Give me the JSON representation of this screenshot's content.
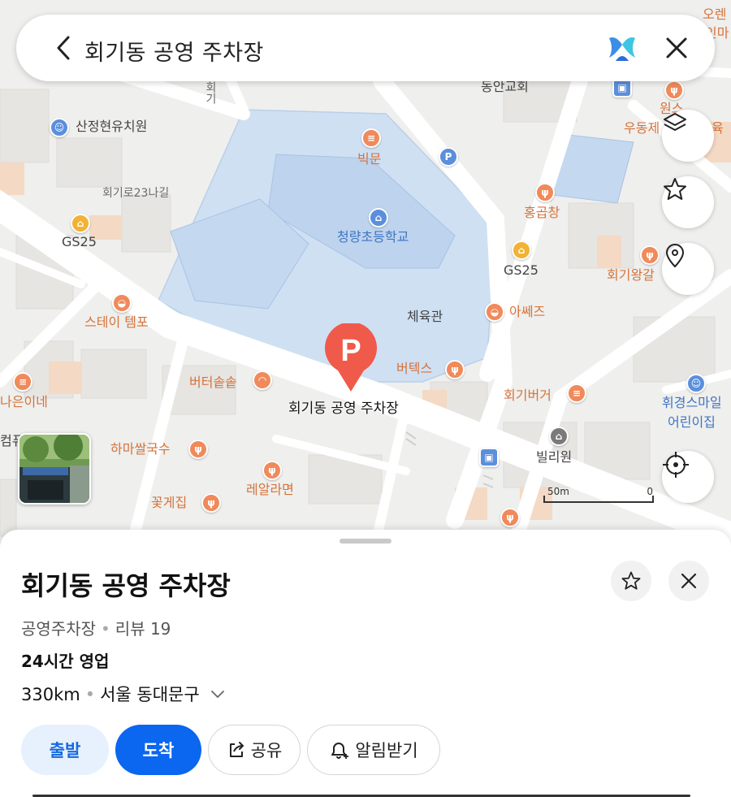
{
  "search": {
    "query": "회기동  공영 주차장"
  },
  "map": {
    "labels": {
      "school": "청량초등학교",
      "gym": "체육관",
      "church": "동안교회",
      "kinder1": "산정현유치원",
      "road1": "회기로23나길",
      "gs25_1": "GS25",
      "gs25_2": "GS25",
      "bakery": "빅문",
      "hong": "홍곱창",
      "hoegi_wang": "회기왕갈",
      "aseez": "아쎄즈",
      "buttex": "버텍스",
      "hoegi_burger": "회기버거",
      "stay_tempo": "스테이 템포",
      "butter_sol": "버터솥솥",
      "nai": "나은이네",
      "hama": "하마쌀국수",
      "real_ramen": "레알라면",
      "kkot": "꽃게집",
      "billy": "빌리원",
      "huikyung": "휘경스마일",
      "huikyung2": "어린이집",
      "orange1": "오렌",
      "orange2": "인마",
      "won": "원스",
      "udong": "우동제",
      "udong2": "육",
      "computer": "컴퓨",
      "vertical_road": "회기"
    },
    "parking_label": "회기동  공영 주차장",
    "parking_icon": "P",
    "scale_left": "50m",
    "scale_right": "0"
  },
  "place": {
    "title": "회기동  공영 주차장",
    "category": "공영주차장",
    "review": "리뷰 19",
    "hours": "24시간 영업",
    "distance": "330km",
    "address": "서울 동대문구"
  },
  "actions": {
    "start": "출발",
    "arrive": "도착",
    "share": "공유",
    "alarm": "알림받기"
  },
  "colors": {
    "accent": "#0b66f0",
    "accent_light": "#e6f1fd",
    "parking_pin": "#f05a4a",
    "poi_orange": "#f08a5b",
    "school_area": "#cfe0f3"
  }
}
